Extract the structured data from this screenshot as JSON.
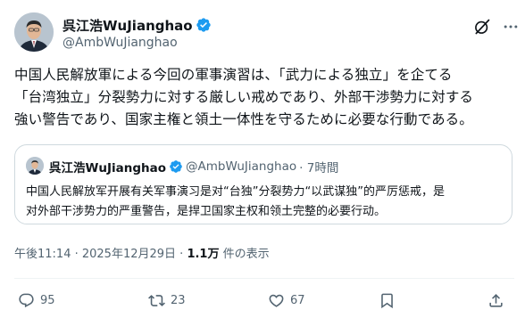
{
  "author": {
    "display_name": "呉江浩WuJianghao",
    "handle": "@AmbWuJianghao"
  },
  "tweet": {
    "line1": "中国人民解放軍による今回の軍事演習は、「武力による独立」を企てる",
    "line2": "「台湾独立」分裂勢力に対する厳しい戒めであり、外部干渉勢力に対する",
    "line3": "強い警告であり、国家主権と領土一体性を守るために必要な行動である。"
  },
  "quote": {
    "display_name": "呉江浩WuJianghao",
    "handle": "@AmbWuJianghao",
    "time": "· 7時間",
    "line1": "中国人民解放军开展有关军事演习是对“台独”分裂势力“以武谋独”的严厉惩戒，是",
    "line2": "对外部干涉势力的严重警告，是捍卫国家主权和领土完整的必要行动。"
  },
  "meta": {
    "timestamp": "午後11:14 · 2025年12月29日 · ",
    "views_count": "1.1万",
    "views_label": " 件の表示"
  },
  "actions": {
    "replies": "95",
    "reposts": "23",
    "likes": "67"
  },
  "colors": {
    "verified": "#1d9bf0",
    "secondary_text": "#536471",
    "border": "#cfd9de"
  }
}
